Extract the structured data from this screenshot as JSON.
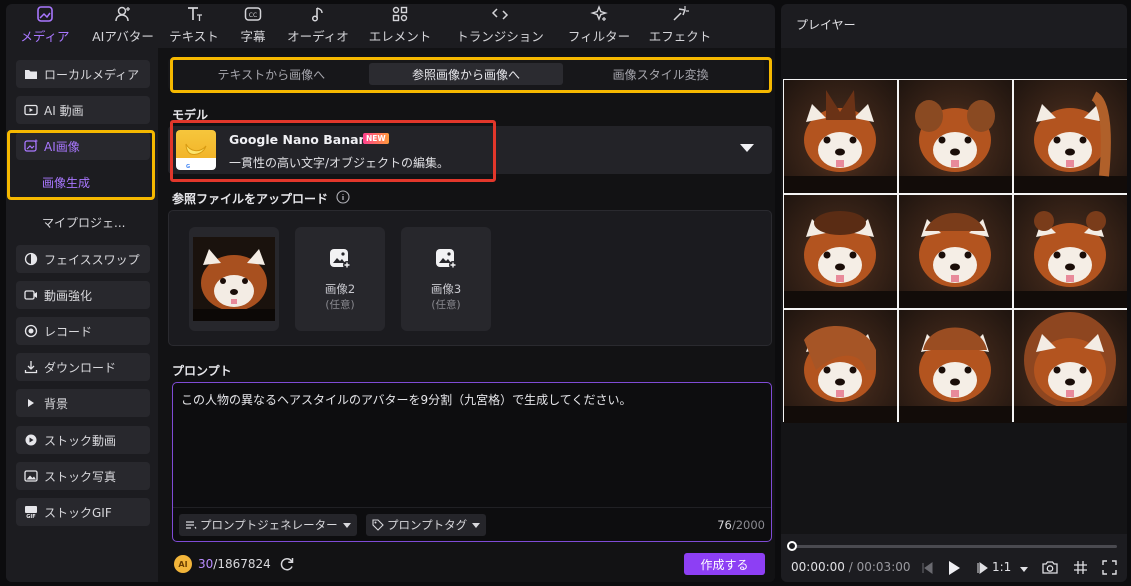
{
  "nav": [
    {
      "label": "メディア",
      "icon": "media-icon",
      "active": true
    },
    {
      "label": "AIアバター",
      "icon": "avatar-icon"
    },
    {
      "label": "テキスト",
      "icon": "text-icon"
    },
    {
      "label": "字幕",
      "icon": "caption-icon"
    },
    {
      "label": "オーディオ",
      "icon": "audio-icon"
    },
    {
      "label": "エレメント",
      "icon": "element-icon"
    },
    {
      "label": "トランジション",
      "icon": "transition-icon"
    },
    {
      "label": "フィルター",
      "icon": "filter-icon"
    },
    {
      "label": "エフェクト",
      "icon": "effect-icon"
    }
  ],
  "sidebar": {
    "items": [
      {
        "label": "ローカルメディア",
        "icon": "folder-icon"
      },
      {
        "label": "AI 動画",
        "icon": "ai-video-icon"
      },
      {
        "label": "AI画像",
        "icon": "ai-image-icon"
      },
      {
        "label": "画像生成"
      },
      {
        "label": "マイプロジェ..."
      },
      {
        "label": "フェイススワップ",
        "icon": "face-swap-icon"
      },
      {
        "label": "動画強化",
        "icon": "enhance-icon"
      },
      {
        "label": "レコード",
        "icon": "record-icon"
      },
      {
        "label": "ダウンロード",
        "icon": "download-icon"
      },
      {
        "label": "背景",
        "icon": "triangle-icon"
      },
      {
        "label": "ストック動画",
        "icon": "stock-video-icon"
      },
      {
        "label": "ストック写真",
        "icon": "stock-photo-icon"
      },
      {
        "label": "ストックGIF",
        "icon": "gif-icon"
      }
    ]
  },
  "tabs": [
    "テキストから画像へ",
    "参照画像から画像へ",
    "画像スタイル変換"
  ],
  "model": {
    "section_label": "モデル",
    "name": "Google Nano Banana",
    "badge": "NEW",
    "description": "一貫性の高い文字/オブジェクトの編集。"
  },
  "upload": {
    "label": "参照ファイルをアップロード",
    "slots": [
      {
        "label": "画像2",
        "hint": "(任意)"
      },
      {
        "label": "画像3",
        "hint": "(任意)"
      }
    ]
  },
  "prompt": {
    "label": "プロンプト",
    "text": "この人物の異なるヘアスタイルのアバターを9分割（九宮格）で生成してください。",
    "generator_btn": "プロンプトジェネレーター",
    "tag_btn": "プロンプトタグ",
    "count": "76",
    "max": "/2000"
  },
  "credits": {
    "used": "30",
    "total": "/1867824"
  },
  "generate_btn": "作成する",
  "player": {
    "title": "プレイヤー",
    "current_time": "00:00:00",
    "separator": "/",
    "total_time": "00:03:00",
    "ratio": "1:1",
    "progress": 0
  },
  "colors": {
    "accent": "#a977ff",
    "highlight_yellow": "#f5b800",
    "highlight_red": "#e2372b",
    "generate": "#8d3ff4"
  }
}
